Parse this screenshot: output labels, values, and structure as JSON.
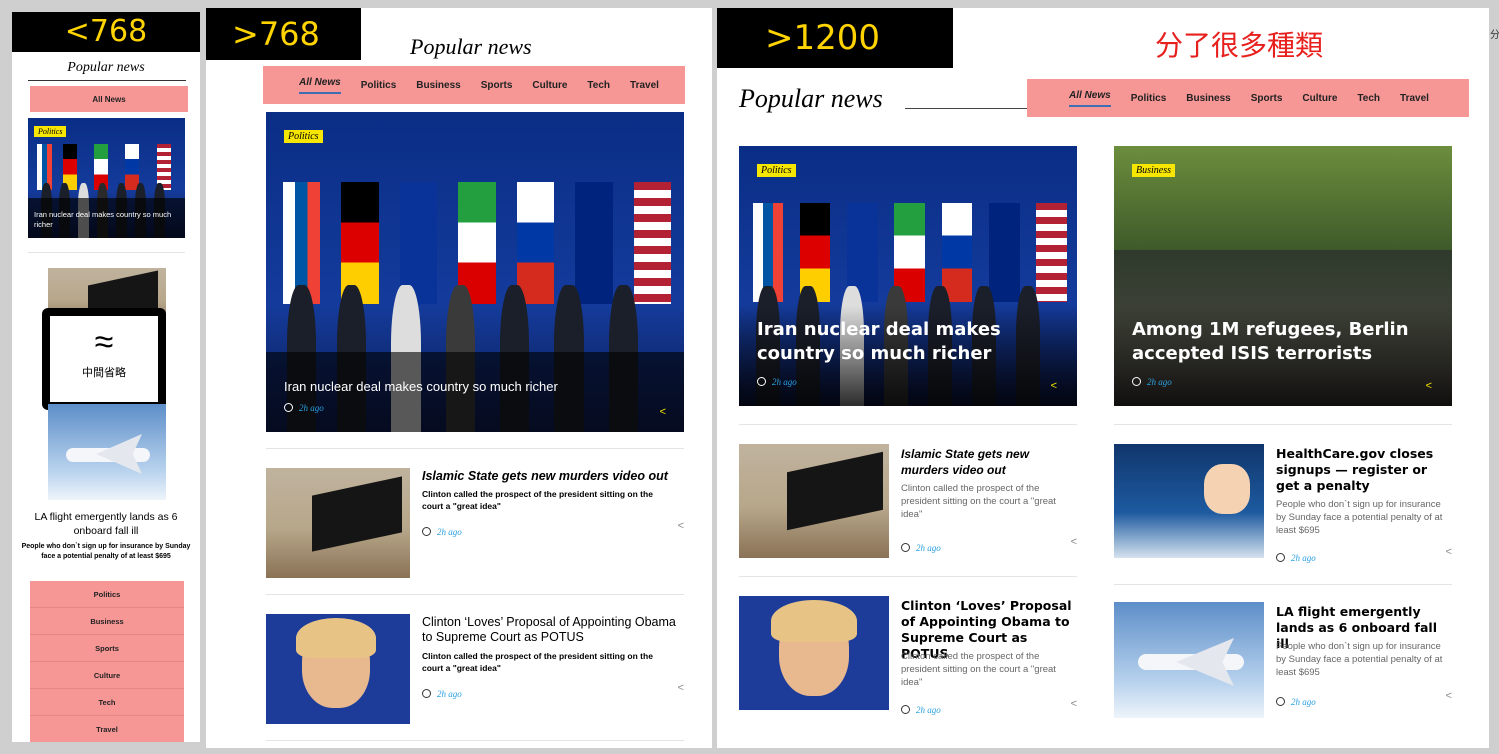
{
  "labels": {
    "small": "<768",
    "medium": ">768",
    "large": ">1200",
    "annotation": "分了很多種類",
    "approx_symbol": "≈",
    "approx_caption": "中間省略",
    "edge_char": "分"
  },
  "header": {
    "title": "Popular news"
  },
  "nav": {
    "items": [
      "All News",
      "Politics",
      "Business",
      "Sports",
      "Culture",
      "Tech",
      "Travel"
    ]
  },
  "articles": {
    "iran": {
      "category": "Politics",
      "title": "Iran nuclear deal makes country so much richer",
      "time": "2h ago"
    },
    "refugees": {
      "category": "Business",
      "title": "Among 1M refugees, Berlin accepted ISIS terrorists",
      "time": "2h ago"
    },
    "isis": {
      "title": "Islamic State gets new murders video out",
      "summary_bold": "Clinton called the prospect of the president sitting on the court a \"great idea\"",
      "summary": "Clinton called the prospect of the president sitting on the court a \"great idea\"",
      "time": "2h ago"
    },
    "clinton": {
      "title": "Clinton ‘Loves’ Proposal of Appointing Obama to Supreme Court as POTUS",
      "summary_bold": "Clinton called the prospect of the president sitting on the court a \"great idea\"",
      "summary": "Clinton called the prospect of the president sitting on the court a \"great idea\"",
      "time": "2h ago"
    },
    "healthcare": {
      "title": "HealthCare.gov closes signups — register or get a penalty",
      "summary": "People who don`t sign up for insurance by Sunday face a potential penalty of at least $695",
      "time": "2h ago"
    },
    "la": {
      "title": "LA flight emergently lands as 6 onboard fall ill",
      "summary": "People who don`t sign up for insurance by Sunday face a potential penalty of at least $695",
      "time": "2h ago"
    }
  },
  "colors": {
    "nav_bg": "#f69796",
    "tag_bg": "#f7e600",
    "time_text": "#2aa0e0",
    "share_yellow": "#f7e600",
    "active_underline": "#3f6fb2",
    "annotation_red": "#e8201d"
  }
}
